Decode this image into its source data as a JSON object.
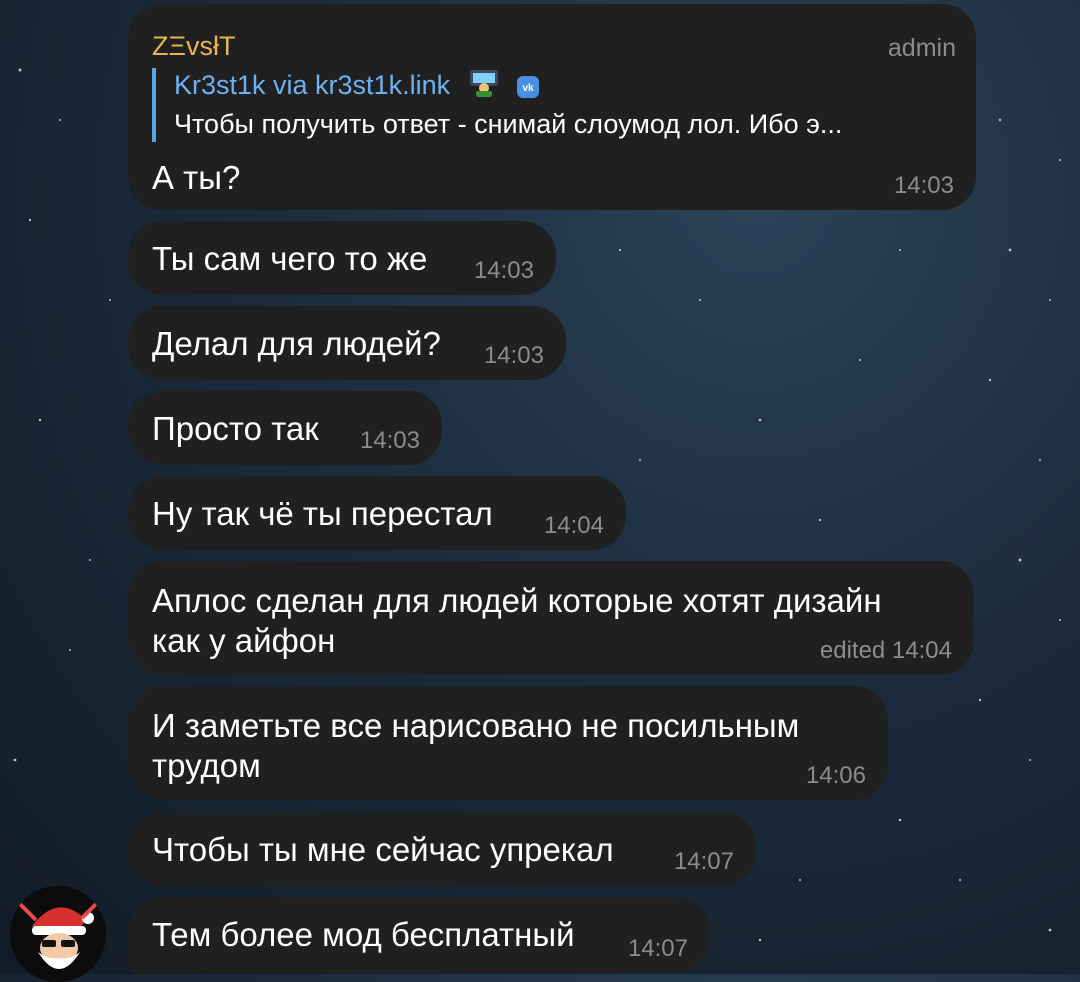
{
  "header_message": {
    "sender": "ZΞvsłT",
    "badge": "admin",
    "reply": {
      "author": "Kr3st1k via kr3st1k.link",
      "text": "Чтобы получить ответ - снимай слоумод лол.  Ибо э..."
    },
    "text": "А ты?",
    "time": "14:03"
  },
  "messages": [
    {
      "text": "Ты сам чего то же",
      "time": "14:03"
    },
    {
      "text": "Делал для людей?",
      "time": "14:03"
    },
    {
      "text": "Просто так",
      "time": "14:03"
    },
    {
      "text": "Ну так чё ты перестал",
      "time": "14:04"
    },
    {
      "text_line1": "Аплос сделан для людей которые хотят дизайн",
      "text_line2": "как у айфон",
      "time": "edited 14:04"
    },
    {
      "text_line1": "И заметьте все нарисовано не посильным",
      "text_line2": "трудом",
      "time": "14:06"
    },
    {
      "text": "Чтобы ты мне сейчас упрекал",
      "time": "14:07"
    },
    {
      "text": "Тем более мод бесплатный",
      "time": "14:07"
    }
  ],
  "icons": {
    "reply_emoji": "technologist-emoji-icon",
    "reply_badge": "vk-icon",
    "avatar": "santa-avatar-icon"
  },
  "colors": {
    "bubble": "#202020",
    "sender": "#e8b64a",
    "reply_accent": "#5aa6e6",
    "time": "#8c8c8c"
  }
}
